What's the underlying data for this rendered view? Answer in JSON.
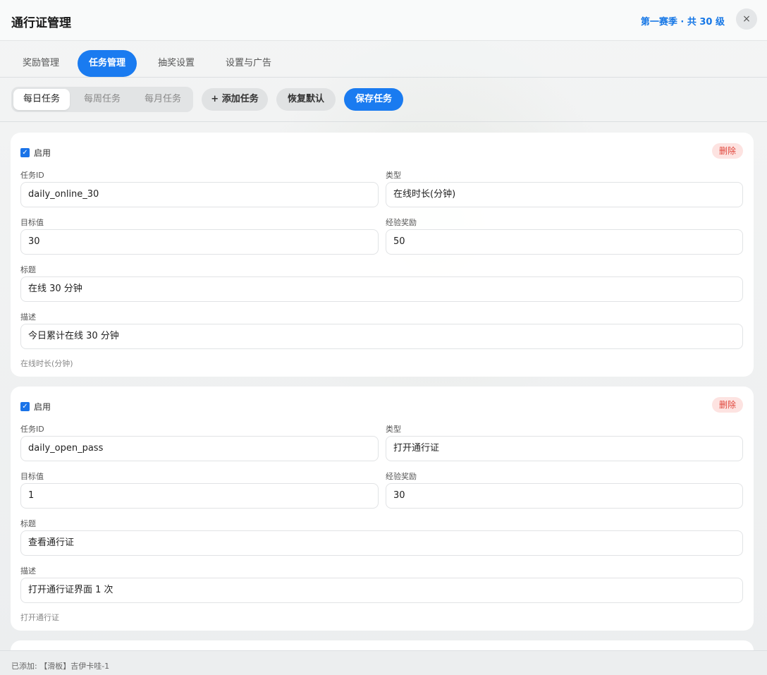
{
  "header": {
    "title": "通行证管理",
    "season": "第一赛季 · 共 30 级",
    "close_label": "×"
  },
  "tabs": [
    {
      "label": "奖励管理"
    },
    {
      "label": "任务管理",
      "active": true
    },
    {
      "label": "抽奖设置"
    },
    {
      "label": "设置与广告"
    }
  ],
  "toolbar": {
    "segments": [
      {
        "label": "每日任务",
        "active": true
      },
      {
        "label": "每周任务"
      },
      {
        "label": "每月任务"
      }
    ],
    "add_label": "+ 添加任务",
    "reset_label": "恢复默认",
    "save_label": "保存任务"
  },
  "labels": {
    "enabled": "启用",
    "delete": "删除",
    "task_id": "任务ID",
    "type": "类型",
    "target": "目标值",
    "xp": "经验奖励",
    "title": "标题",
    "desc": "描述"
  },
  "tasks": [
    {
      "enabled": true,
      "task_id": "daily_online_30",
      "type": "在线时长(分钟)",
      "target": "30",
      "xp": "50",
      "title": "在线 30 分钟",
      "desc": "今日累计在线 30 分钟",
      "hint": "在线时长(分钟)"
    },
    {
      "enabled": true,
      "task_id": "daily_open_pass",
      "type": "打开通行证",
      "target": "1",
      "xp": "30",
      "title": "查看通行证",
      "desc": "打开通行证界面 1 次",
      "hint": "打开通行证"
    }
  ],
  "footer": {
    "status": "已添加: 【滑板】吉伊卡哇-1"
  },
  "colors": {
    "accent": "#1a7bf0",
    "danger": "#e0463b"
  }
}
